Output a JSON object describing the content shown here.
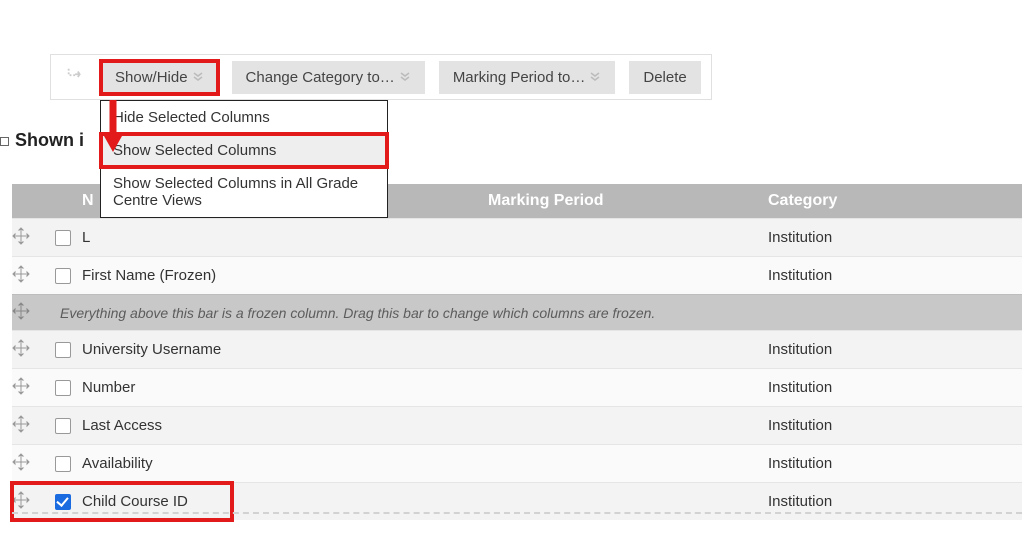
{
  "toolbar": {
    "show_hide": "Show/Hide",
    "change_category": "Change Category to…",
    "marking_period": "Marking Period to…",
    "delete": "Delete"
  },
  "section_label": "Shown i",
  "dropdown": {
    "hide": "Hide Selected Columns",
    "show": "Show Selected Columns",
    "show_all": "Show Selected Columns in All Grade Centre Views"
  },
  "columns": {
    "name": "N",
    "marking": "Marking Period",
    "category": "Category"
  },
  "frozen_msg": "Everything above this bar is a frozen column. Drag this bar to change which columns are frozen.",
  "rows": [
    {
      "name": "L",
      "category": "Institution",
      "checked": false
    },
    {
      "name": "First Name (Frozen)",
      "category": "Institution",
      "checked": false
    }
  ],
  "rows2": [
    {
      "name": "University Username",
      "category": "Institution",
      "checked": false
    },
    {
      "name": "Number",
      "category": "Institution",
      "checked": false
    },
    {
      "name": "Last Access",
      "category": "Institution",
      "checked": false
    },
    {
      "name": "Availability",
      "category": "Institution",
      "checked": false
    },
    {
      "name": "Child Course ID",
      "category": "Institution",
      "checked": true
    }
  ]
}
